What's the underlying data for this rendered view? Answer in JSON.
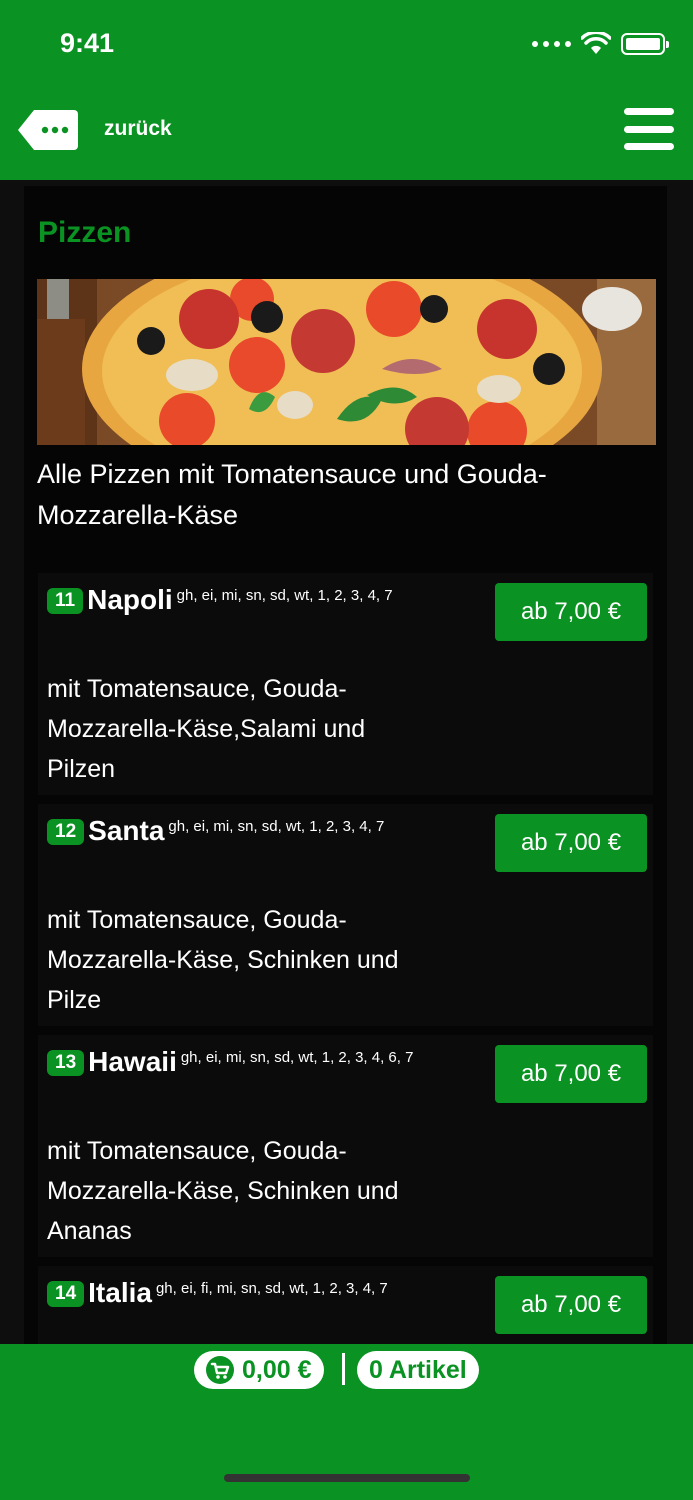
{
  "status_bar": {
    "time": "9:41"
  },
  "nav": {
    "back_label": "zurück"
  },
  "section": {
    "title": "Pizzen",
    "intro": "Alle Pizzen mit Tomatensauce und Gouda-Mozzarella-Käse"
  },
  "items": [
    {
      "number": "11",
      "name": "Napoli",
      "allergens": "gh, ei, mi, sn, sd, wt, 1, 2, 3, 4, 7",
      "description": "mit Tomatensauce, Gouda-Mozzarella-Käse,Salami und Pilzen",
      "price": "ab 7,00 €"
    },
    {
      "number": "12",
      "name": "Santa",
      "allergens": "gh, ei, mi, sn, sd, wt, 1, 2, 3, 4, 7",
      "description": "mit Tomatensauce, Gouda-Mozzarella-Käse, Schinken und Pilze",
      "price": "ab 7,00 €"
    },
    {
      "number": "13",
      "name": "Hawaii",
      "allergens": "gh, ei, mi, sn, sd, wt, 1, 2, 3, 4, 6, 7",
      "description": "mit Tomatensauce, Gouda-Mozzarella-Käse, Schinken und Ananas",
      "price": "ab 7,00 €"
    },
    {
      "number": "14",
      "name": "Italia",
      "allergens": "gh, ei, fi, mi, sn, sd, wt, 1, 2, 3, 4, 7",
      "description": "",
      "price": "ab 7,00 €"
    }
  ],
  "cart": {
    "total": "0,00 €",
    "count": "0 Artikel"
  },
  "colors": {
    "brand": "#0a9222",
    "background": "#050505"
  },
  "icons": {
    "back": "speech-bubble-back-icon",
    "menu": "hamburger-icon",
    "cart": "cart-icon"
  }
}
